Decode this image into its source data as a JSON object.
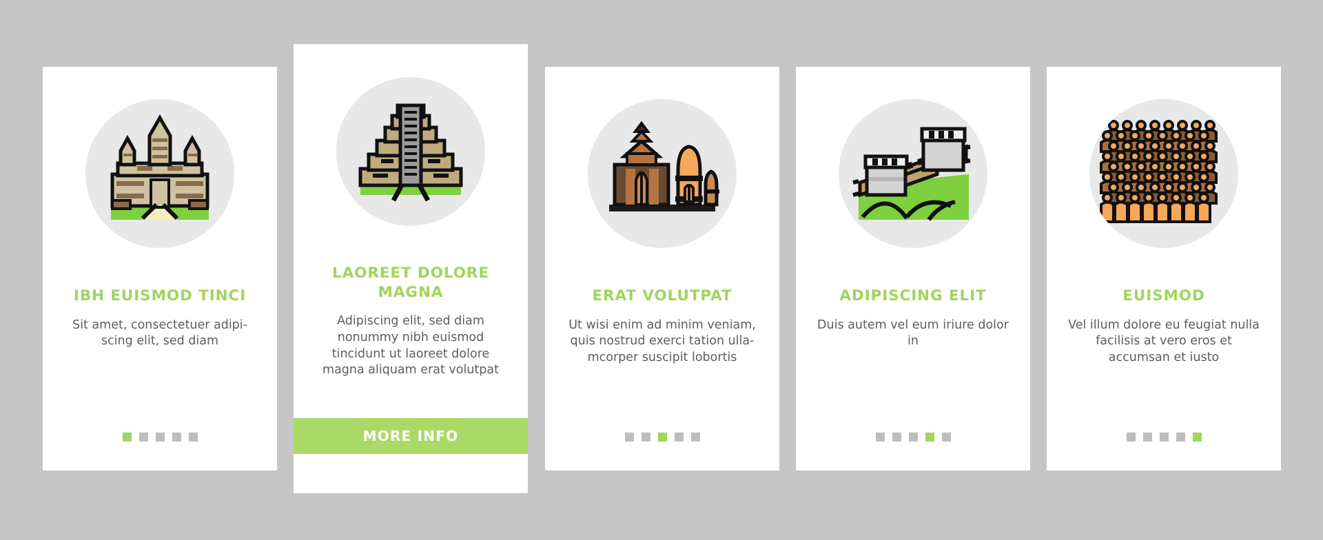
{
  "page": {
    "background_color": "#c6c6c6",
    "accent_color": "#a2d45e",
    "card_background": "#ffffff",
    "icon_circle_color": "#e8e8e8",
    "body_text_color": "#5d5d5d",
    "dot_inactive_color": "#bdbdbd"
  },
  "cards": [
    {
      "id": "card-1",
      "featured": false,
      "icon": "angkor-wat-temple-icon",
      "title": "IBH EUISMOD TINCI",
      "body": "Sit amet, consectetuer adipi-scing elit, sed diam",
      "dots": {
        "total": 5,
        "active_index": 0
      }
    },
    {
      "id": "card-2",
      "featured": true,
      "icon": "mayan-step-pyramid-icon",
      "title": "LAOREET DOLORE MAGNA",
      "body": "Adipiscing elit, sed diam nonummy nibh euismod tincidunt ut laoreet dolore magna aliquam erat volutpat",
      "cta_label": "MORE INFO",
      "cta_color": "#a9da67"
    },
    {
      "id": "card-3",
      "featured": false,
      "icon": "prambanan-temple-icon",
      "title": "ERAT VOLUTPAT",
      "body": "Ut wisi enim ad minim veniam, quis nostrud exerci tation ulla-mcorper suscipit lobortis",
      "dots": {
        "total": 5,
        "active_index": 2
      }
    },
    {
      "id": "card-4",
      "featured": false,
      "icon": "great-wall-of-china-icon",
      "title": "ADIPISCING ELIT",
      "body": "Duis autem vel eum iriure dolor in",
      "dots": {
        "total": 5,
        "active_index": 3
      }
    },
    {
      "id": "card-5",
      "featured": false,
      "icon": "terracotta-army-icon",
      "title": "EUISMOD",
      "body": "Vel illum dolore eu feugiat nulla facilisis at vero eros et accumsan et iusto",
      "dots": {
        "total": 5,
        "active_index": 4
      }
    }
  ]
}
